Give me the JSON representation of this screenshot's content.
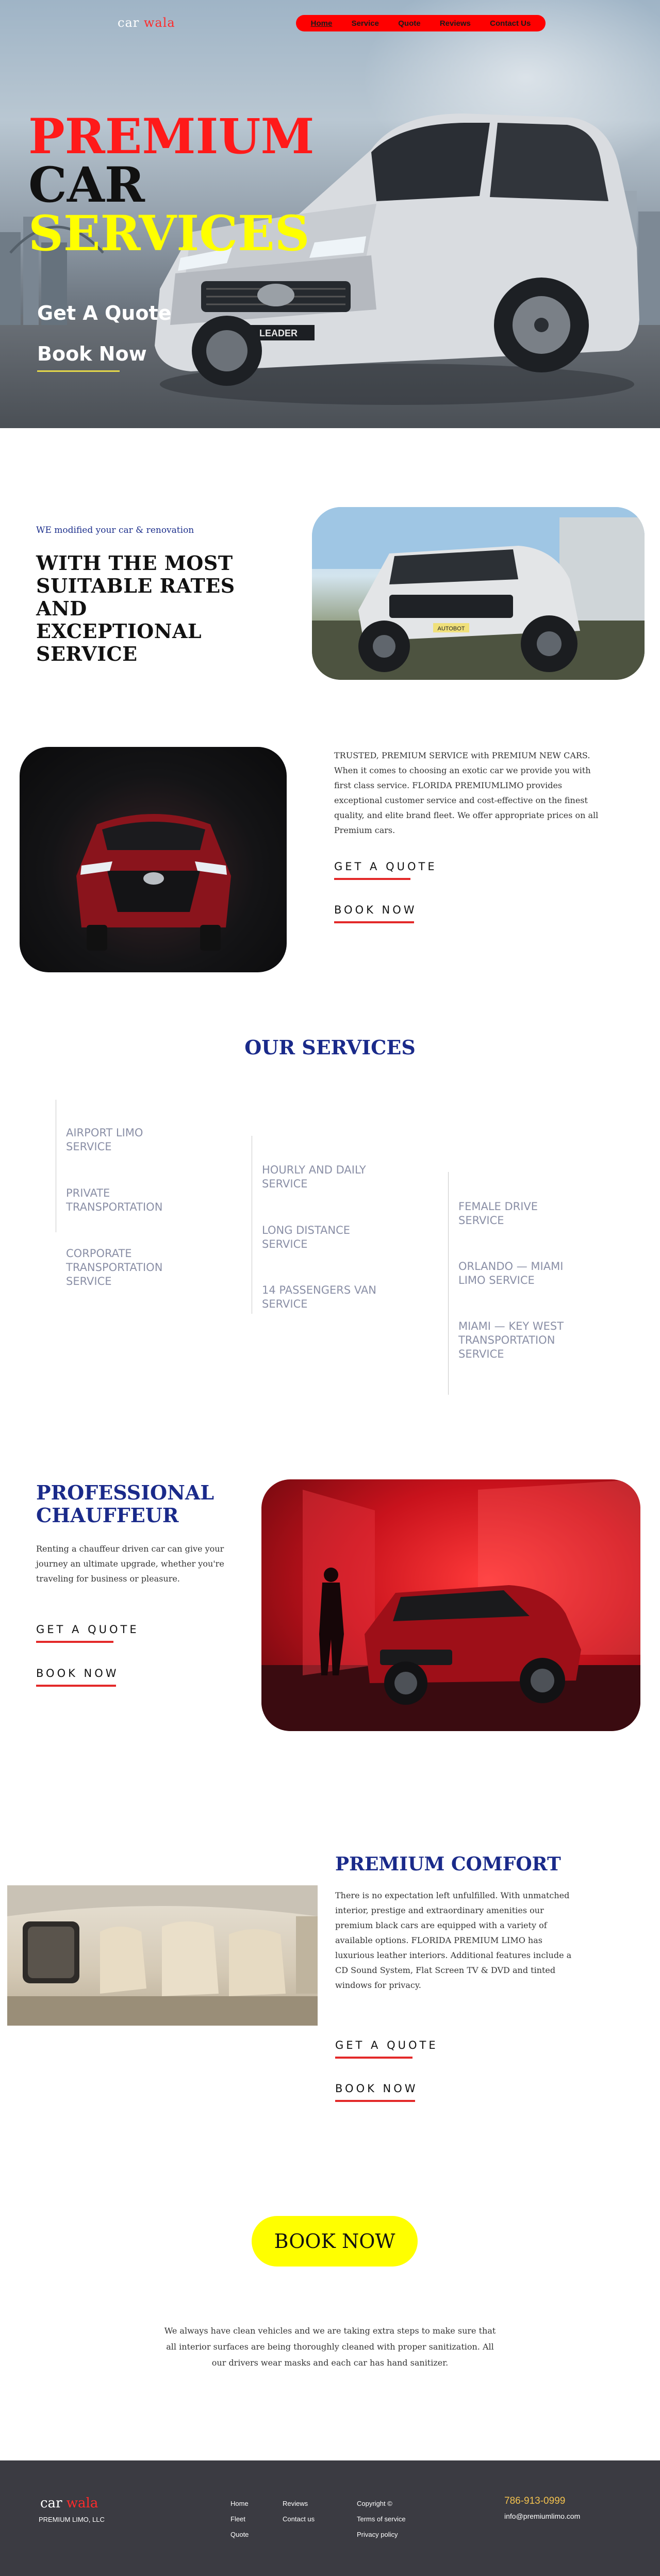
{
  "brand": {
    "part1": "car",
    "part2": "wala"
  },
  "nav": [
    "Home",
    "Service",
    "Quote",
    "Reviews",
    "Contact Us"
  ],
  "hero": {
    "line1": "PREMIUM",
    "line2": "CAR",
    "line3": "SERVICES",
    "quote_btn": "Get A Quote",
    "book_btn": "Book Now",
    "plate_text": "LEADER"
  },
  "section_modified": {
    "kicker": "WE modified your car & renovation",
    "heading": "WITH THE MOST SUITABLE RATES AND EXCEPTIONAL SERVICE",
    "plate_text": "AUTOBOT"
  },
  "section_trusted": {
    "text": "TRUSTED, PREMIUM SERVICE with PREMIUM NEW CARS. When it comes to choosing an exotic car we provide you with first class service. FLORIDA PREMIUMLIMO provides exceptional customer service and cost-effective on the finest quality, and elite brand fleet. We offer appropriate prices on all Premium cars.",
    "cta_quote": "GET A QUOTE",
    "cta_book": "BOOK NOW"
  },
  "services": {
    "title": "OUR SERVICES",
    "col1": [
      "AIRPORT LIMO SERVICE",
      "PRIVATE TRANSPORTATION",
      "CORPORATE TRANSPORTATION SERVICE"
    ],
    "col2": [
      "HOURLY AND DAILY SERVICE",
      "LONG DISTANCE SERVICE",
      "14 PASSENGERS VAN SERVICE"
    ],
    "col3": [
      "FEMALE DRIVE SERVICE",
      "ORLANDO — MIAMI LIMO SERVICE",
      "MIAMI — KEY WEST TRANSPORTATION SERVICE"
    ]
  },
  "chauffeur": {
    "title": "PROFESSIONAL CHAUFFEUR",
    "text": "Renting a chauffeur driven car can give your journey an ultimate upgrade, whether you're traveling for business or pleasure.",
    "cta_quote": "GET A QUOTE",
    "cta_book": "BOOK NOW"
  },
  "comfort": {
    "title": "PREMIUM COMFORT",
    "text": "There is no expectation left unfulfilled. With unmatched interior, prestige and extraordinary amenities our premium black cars are equipped with a variety of available options. FLORIDA PREMIUM LIMO has luxurious leather interiors. Additional features include a CD Sound System, Flat Screen TV & DVD and tinted windows for privacy.",
    "cta_quote": "GET A QUOTE",
    "cta_book": "BOOK NOW"
  },
  "book_now_big": "BOOK NOW",
  "final_note": "We always have clean vehicles and we are taking extra steps to make sure that all interior surfaces are being thoroughly cleaned with proper sanitization. All our drivers wear masks and each car has hand sanitizer.",
  "footer": {
    "brand1": "car",
    "brand2": "wala",
    "sub": "PREMIUM LIMO, LLC",
    "col1": [
      "Home",
      "Fleet",
      "Quote"
    ],
    "col2": [
      "Reviews",
      "Contact us"
    ],
    "col3": [
      "Copyright ©",
      "Terms of service",
      "Privacy policy"
    ],
    "phone": "786-913-0999",
    "email": "info@premiumlimo.com"
  },
  "colors": {
    "accent_red": "#ff0000",
    "accent_yellow": "#ffff00",
    "navy": "#1a2a8a",
    "footer_bg": "#3b3b42"
  }
}
